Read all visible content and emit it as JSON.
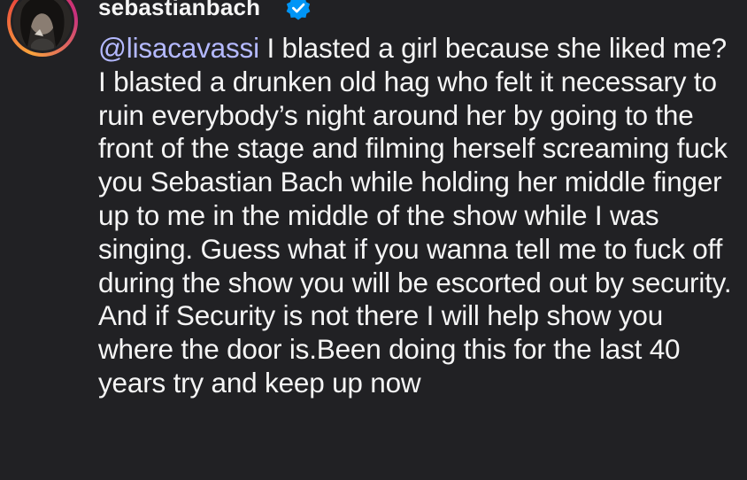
{
  "comment": {
    "username": "sebastianbach",
    "verified_icon": "verified-badge-icon",
    "avatar_icon": "profile-avatar",
    "mention_symbol": "@",
    "mention_text": "lisacavassi",
    "body": " I blasted a girl because she liked me? I blasted a drunken old hag who felt it necessary to ruin everybody’s night around her by going to the front of the stage and filming herself screaming fuck you Sebastian Bach while holding her middle finger up to me in the middle of the show while I was singing. Guess what if you wanna tell me to fuck off during the show you will be escorted out by security. And if Security is not there I will help show you where the door is.Been doing this for the last 40 years try and keep up now"
  },
  "colors": {
    "background": "#212124",
    "text": "#f5f5f5",
    "mention": "#b4b9ff",
    "verified": "#0095f6"
  }
}
